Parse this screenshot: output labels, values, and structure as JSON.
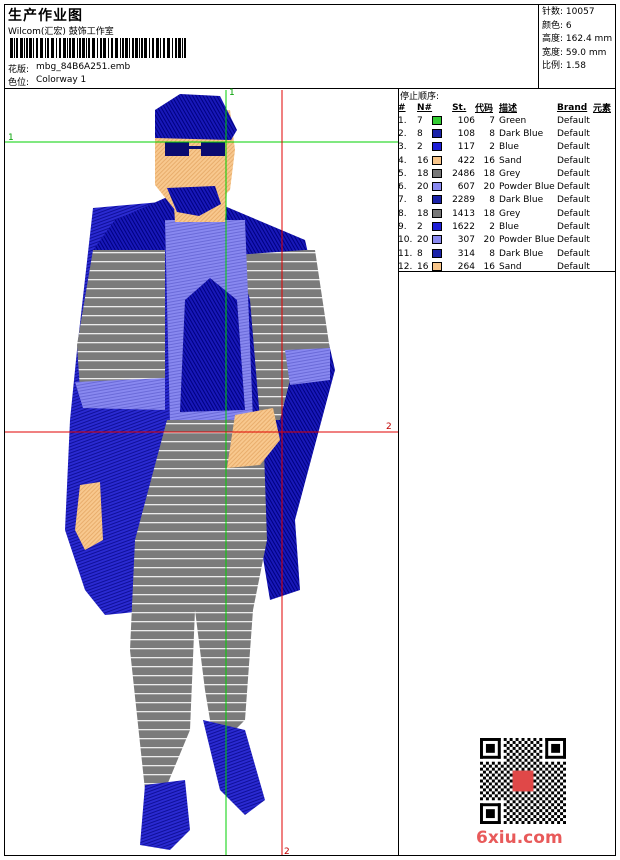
{
  "header": {
    "title": "生产作业图",
    "company": "Wilcom(汇宏) 鼓饰工作室",
    "design_label": "花版:",
    "design_file": "mbg_84B6A251.emb",
    "colorway_label": "色位:",
    "colorway": "Colorway 1"
  },
  "stats": [
    {
      "label": "针数:",
      "value": "10057"
    },
    {
      "label": "颜色:",
      "value": "6"
    },
    {
      "label": "高度:",
      "value": "162.4 mm"
    },
    {
      "label": "宽度:",
      "value": "59.0 mm"
    },
    {
      "label": "比例:",
      "value": "1.58"
    }
  ],
  "stop_sequence": {
    "title": "停止顺序:",
    "headers": [
      "#",
      "N#",
      "St.",
      "代码",
      "描述",
      "Brand",
      "元素"
    ],
    "rows": [
      {
        "num": "1.",
        "n": "7",
        "color": "#33cc33",
        "st": "106",
        "code": "7",
        "desc": "Green",
        "brand": "Default"
      },
      {
        "num": "2.",
        "n": "8",
        "color": "#1a22a8",
        "st": "108",
        "code": "8",
        "desc": "Dark Blue",
        "brand": "Default"
      },
      {
        "num": "3.",
        "n": "2",
        "color": "#1f1fd6",
        "st": "117",
        "code": "2",
        "desc": "Blue",
        "brand": "Default"
      },
      {
        "num": "4.",
        "n": "16",
        "color": "#f7c58a",
        "st": "422",
        "code": "16",
        "desc": "Sand",
        "brand": "Default"
      },
      {
        "num": "5.",
        "n": "18",
        "color": "#777777",
        "st": "2486",
        "code": "18",
        "desc": "Grey",
        "brand": "Default"
      },
      {
        "num": "6.",
        "n": "20",
        "color": "#8a8af0",
        "st": "607",
        "code": "20",
        "desc": "Powder Blue",
        "brand": "Default"
      },
      {
        "num": "7.",
        "n": "8",
        "color": "#1a22a8",
        "st": "2289",
        "code": "8",
        "desc": "Dark Blue",
        "brand": "Default"
      },
      {
        "num": "8.",
        "n": "18",
        "color": "#777777",
        "st": "1413",
        "code": "18",
        "desc": "Grey",
        "brand": "Default"
      },
      {
        "num": "9.",
        "n": "2",
        "color": "#1f1fd6",
        "st": "1622",
        "code": "2",
        "desc": "Blue",
        "brand": "Default"
      },
      {
        "num": "10.",
        "n": "20",
        "color": "#8a8af0",
        "st": "307",
        "code": "20",
        "desc": "Powder Blue",
        "brand": "Default"
      },
      {
        "num": "11.",
        "n": "8",
        "color": "#1a22a8",
        "st": "314",
        "code": "8",
        "desc": "Dark Blue",
        "brand": "Default"
      },
      {
        "num": "12.",
        "n": "16",
        "color": "#f7c58a",
        "st": "264",
        "code": "16",
        "desc": "Sand",
        "brand": "Default"
      }
    ]
  },
  "guides": {
    "label_1": "1",
    "label_2": "2"
  },
  "watermark": "6xiu.com"
}
